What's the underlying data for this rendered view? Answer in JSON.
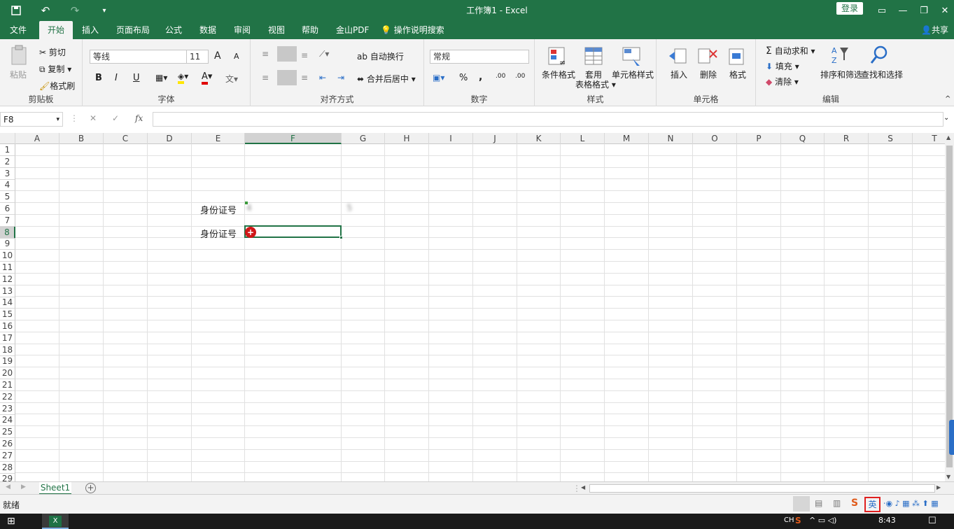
{
  "titlebar": {
    "title": "工作簿1  -  Excel",
    "login": "登录"
  },
  "menu": {
    "tabs": [
      "文件",
      "开始",
      "插入",
      "页面布局",
      "公式",
      "数据",
      "审阅",
      "视图",
      "帮助",
      "金山PDF"
    ],
    "search": "操作说明搜索",
    "share": "共享"
  },
  "clipboard": {
    "paste": "粘贴",
    "cut": "剪切",
    "copy": "复制",
    "painter": "格式刷",
    "label": "剪贴板"
  },
  "font": {
    "name": "等线",
    "size": "11",
    "grow": "A",
    "shrink": "A",
    "bold": "B",
    "italic": "I",
    "underline": "U",
    "fontcolor": "A",
    "label": "字体"
  },
  "align": {
    "wrap": "自动换行",
    "merge": "合并后居中",
    "label": "对齐方式"
  },
  "number": {
    "format": "常规",
    "percent": "%",
    "comma": ",",
    "inc": ".00",
    "dec": ".00",
    "label": "数字"
  },
  "styles": {
    "cond": "条件格式",
    "table1": "套用",
    "table2": "表格格式",
    "cell": "单元格样式",
    "label": "样式"
  },
  "cells": {
    "insert": "插入",
    "delete": "删除",
    "format": "格式",
    "label": "单元格"
  },
  "editing": {
    "autosum": "自动求和",
    "fill": "填充",
    "clear": "清除",
    "sort": "排序和筛选",
    "find": "查找和选择",
    "label": "编辑"
  },
  "formula": {
    "namebox": "F8",
    "fx": "fx",
    "cancel": "✕",
    "enter": "✓"
  },
  "grid": {
    "columns": [
      "A",
      "B",
      "C",
      "D",
      "E",
      "F",
      "G",
      "H",
      "I",
      "J",
      "K",
      "L",
      "M",
      "N",
      "O",
      "P",
      "Q",
      "R",
      "S",
      "T"
    ],
    "rows": [
      "1",
      "2",
      "3",
      "4",
      "5",
      "6",
      "7",
      "8",
      "9",
      "10",
      "11",
      "12",
      "13",
      "14",
      "15",
      "16",
      "17",
      "18",
      "19",
      "20",
      "21",
      "22",
      "23",
      "24",
      "25",
      "26",
      "27",
      "28",
      "29"
    ],
    "e6": "身份证号",
    "f6": "4                            5",
    "e8": "身份证号"
  },
  "sheet": {
    "name": "Sheet1",
    "add": "+"
  },
  "status": {
    "ready": "就绪"
  },
  "taskbar": {
    "ch": "CH",
    "time": "8:43",
    "ime": "英"
  }
}
